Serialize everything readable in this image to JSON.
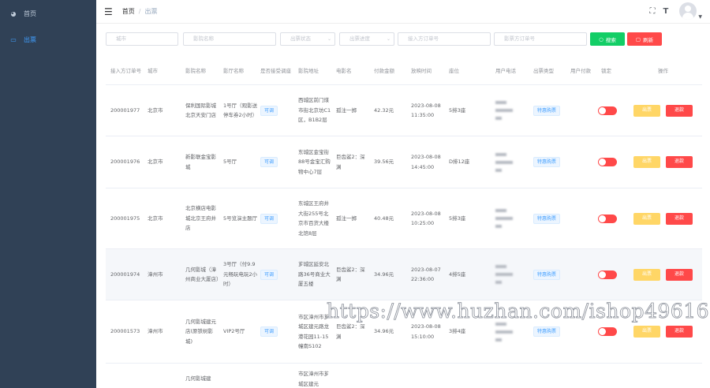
{
  "sidebar": {
    "items": [
      {
        "label": "首页",
        "icon": "dashboard-icon"
      },
      {
        "label": "出票",
        "icon": "ticket-icon"
      }
    ]
  },
  "navbar": {
    "breadcrumb": [
      "首页",
      "出票"
    ],
    "separator": "/"
  },
  "filters": {
    "city": "城市",
    "cinema": "影院名称",
    "status": "出票状态",
    "progress": "出票进度",
    "in_order": "接入方订单号",
    "cinema_order": "影票方订单号",
    "search_label": "搜索",
    "reset_label": "刷新"
  },
  "table": {
    "headers": [
      "接入方订单号",
      "城市",
      "影院名称",
      "影厅名称",
      "是否接受调座",
      "影院地址",
      "电影名",
      "付款金额",
      "放映时间",
      "座位",
      "用户电话",
      "出票类型",
      "用户付款",
      "锁定",
      "操作"
    ],
    "action_labels": {
      "out": "出票",
      "refund": "退款"
    },
    "rows": [
      {
        "order": "200001977",
        "city": "北京市",
        "cinema": "保利国际影城北京天安门店",
        "hall": "1号厅（观影送停车券2小时）",
        "adjust": "可调",
        "address": "西城区前门煤市街北京坊C1区，B1B2层",
        "movie": "孤注一掷",
        "amount": "42.32元",
        "time": "2023-08-08 11:35:00",
        "seat": "5排3座",
        "type": "特惠购票"
      },
      {
        "order": "200001976",
        "city": "北京市",
        "cinema": "新影联金宝影城",
        "hall": "5号厅",
        "adjust": "可调",
        "address": "东城区金宝街88号金宝汇购物中心7层",
        "movie": "巨齿鲨2：深渊",
        "amount": "39.56元",
        "time": "2023-08-08 14:45:00",
        "seat": "D排12座",
        "type": "特惠购票"
      },
      {
        "order": "200001975",
        "city": "北京市",
        "cinema": "北京横店电影城北京王府井店",
        "hall": "5号览演主题厅",
        "adjust": "可调",
        "address": "东城区王府井大街255号北京市百货大楼北馆8层",
        "movie": "孤注一掷",
        "amount": "40.48元",
        "time": "2023-08-08 10:25:00",
        "seat": "5排3座",
        "type": "特惠购票"
      },
      {
        "order": "200001974",
        "city": "漳州市",
        "cinema": "几何影城（漳州商业大厦店）",
        "hall": "3号厅（付9.9元畅玩电玩2小时）",
        "adjust": "可调",
        "address": "芗城区延安北路36号商业大厦五楼",
        "movie": "巨齿鲨2：深渊",
        "amount": "34.96元",
        "time": "2023-08-07 22:36:00",
        "seat": "4排5座",
        "type": "特惠购票"
      },
      {
        "order": "200001573",
        "city": "漳州市",
        "cinema": "几何影城建元店(原铁树影城)",
        "hall": "VIP2号厅",
        "adjust": "可调",
        "address": "市区漳州市芗城区建元路龙港花园11-15幢南S102",
        "movie": "巨齿鲨2：深渊",
        "amount": "34.96元",
        "time": "2023-08-08 15:10:00",
        "seat": "3排4座",
        "type": "特惠购票"
      },
      {
        "order": "",
        "city": "",
        "cinema": "几何影城建",
        "hall": "",
        "adjust": "",
        "address": "市区漳州市芗城区建元",
        "movie": "",
        "amount": "",
        "time": "",
        "seat": "",
        "type": ""
      }
    ]
  },
  "watermark": "https://www.huzhan.com/ishop49616",
  "colors": {
    "sidebar": "#304156",
    "primary": "#409eff",
    "success": "#13ce66",
    "danger": "#ff4949",
    "warning": "#ffd666"
  }
}
